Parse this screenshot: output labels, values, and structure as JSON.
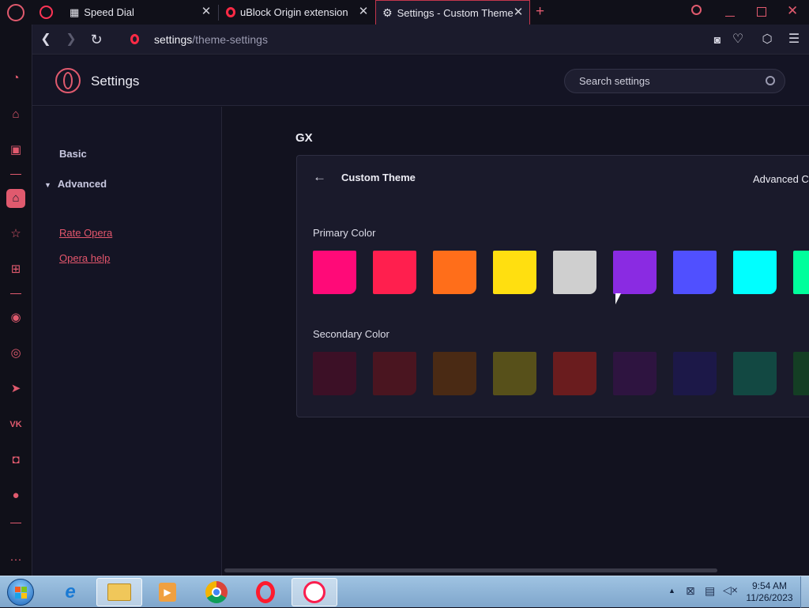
{
  "tabs": [
    {
      "title": "Speed Dial",
      "icon": "grid-icon"
    },
    {
      "title": "uBlock Origin extension - C",
      "icon": "opera-icon"
    },
    {
      "title": "Settings - Custom Theme",
      "icon": "gear-icon",
      "active": true
    }
  ],
  "address": {
    "host": "settings",
    "path": "/theme-settings"
  },
  "header": {
    "title": "Settings",
    "search_placeholder": "Search settings"
  },
  "nav": {
    "basic": "Basic",
    "advanced": "Advanced",
    "rate": "Rate Opera",
    "help": "Opera help"
  },
  "main": {
    "section": "GX",
    "card_title": "Custom Theme",
    "advanced_label": "Advanced Co",
    "primary_label": "Primary Color",
    "secondary_label": "Secondary Color",
    "primary_colors": [
      "#ff0a78",
      "#ff1f4e",
      "#ff6e1a",
      "#ffdf10",
      "#cfcfcf",
      "#8a2be2",
      "#5050ff",
      "#00ffff",
      "#00ff9c"
    ],
    "secondary_colors": [
      "#3c1026",
      "#4a1520",
      "#4a2a14",
      "#57501a",
      "#6a1c1e",
      "#2e1440",
      "#1c1848",
      "#124842",
      "#143e24"
    ]
  },
  "taskbar": {
    "time": "9:54 AM",
    "date": "11/26/2023"
  }
}
